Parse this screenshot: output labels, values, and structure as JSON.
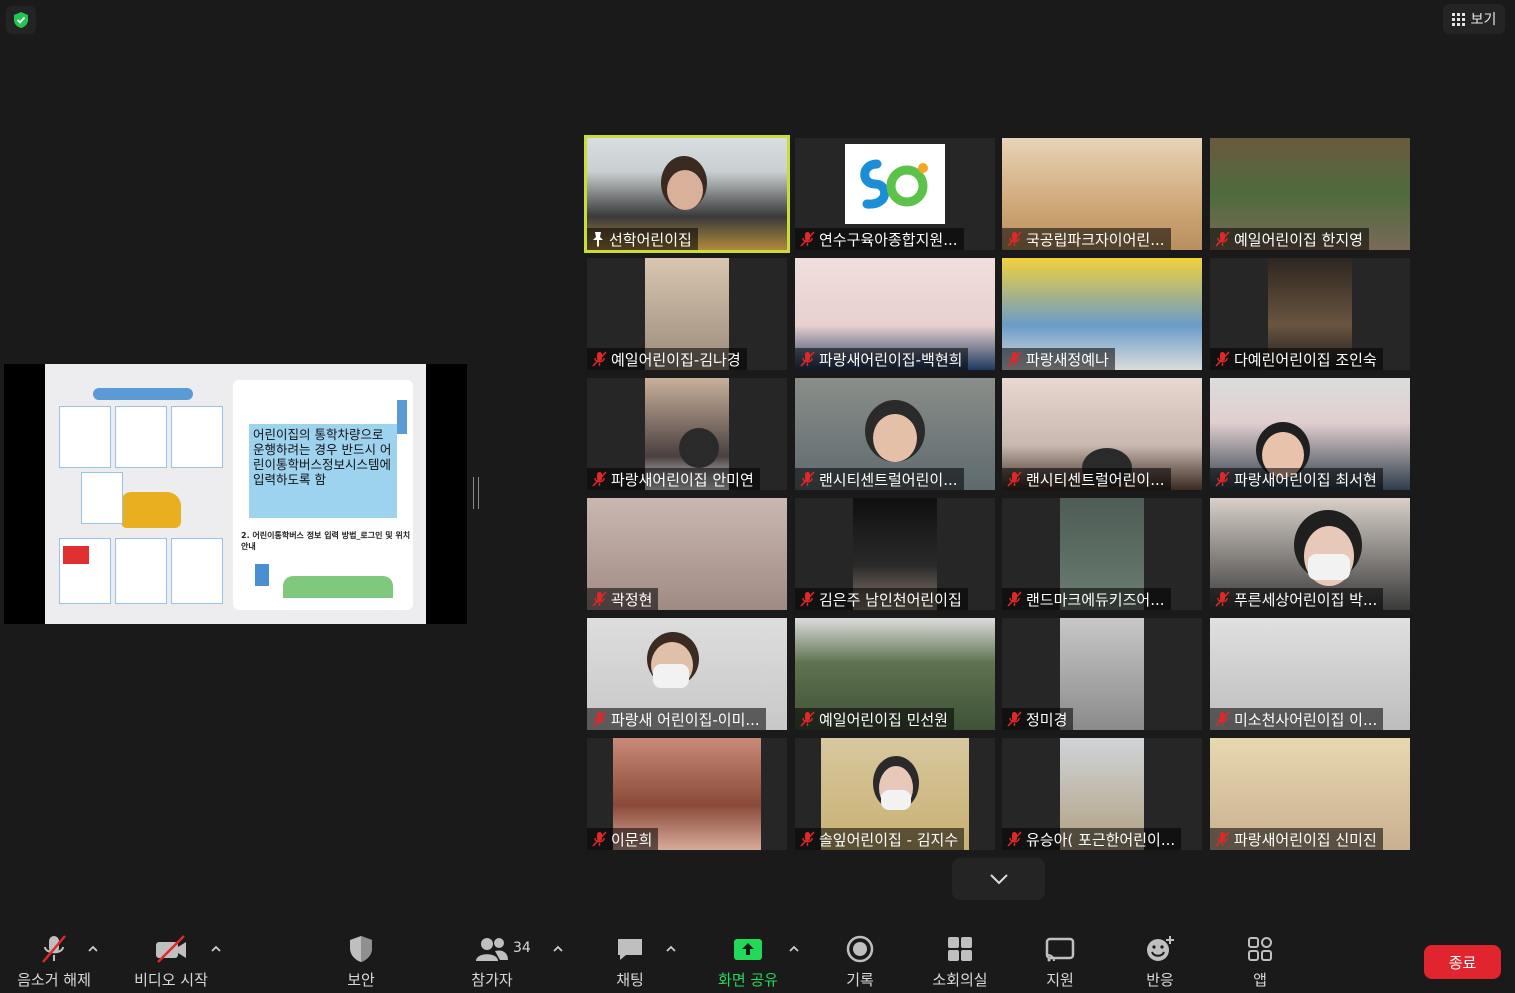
{
  "top_right": {
    "view_label": "보기"
  },
  "shared_slide": {
    "main_text": "어린이집의 통학차량으로 운행하려는 경우 반드시 어린이통학버스정보시스템에 입력하도록 함",
    "subheading": "2. 어린이통학버스 정보 입력 방법_로그인 및 위치 안내"
  },
  "participants": [
    {
      "name": "선학어린이집",
      "pinned": true,
      "muted": false,
      "active_speaker": true
    },
    {
      "name": "연수구육아종합지원...",
      "muted": true
    },
    {
      "name": "국공립파크자이어린...",
      "muted": true
    },
    {
      "name": "예일어린이집 한지영",
      "muted": true
    },
    {
      "name": "예일어린이집-김나경",
      "muted": true
    },
    {
      "name": "파랑새어린이집-백현희",
      "muted": true
    },
    {
      "name": "파랑새정예나",
      "muted": true
    },
    {
      "name": "다예린어린이집 조인숙",
      "muted": true
    },
    {
      "name": "파랑새어린이집 안미연",
      "muted": true
    },
    {
      "name": "랜시티센트럴어린이...",
      "muted": true
    },
    {
      "name": "랜시티센트럴어린이...",
      "muted": true
    },
    {
      "name": "파랑새어린이집 최서현",
      "muted": true
    },
    {
      "name": "곽정현",
      "muted": true
    },
    {
      "name": "김은주 남인천어린이집",
      "muted": true
    },
    {
      "name": "랜드마크에듀키즈어...",
      "muted": true
    },
    {
      "name": "푸른세상어린이집 박...",
      "muted": true
    },
    {
      "name": "파랑새 어린이집-이미...",
      "muted": true
    },
    {
      "name": "예일어린이집 민선원",
      "muted": true
    },
    {
      "name": "정미경",
      "muted": true
    },
    {
      "name": "미소천사어린이집 이...",
      "muted": true
    },
    {
      "name": "이문희",
      "muted": true
    },
    {
      "name": "솔잎어린이집 - 김지수",
      "muted": true
    },
    {
      "name": "유승아( 포근한어린이...",
      "muted": true
    },
    {
      "name": "파랑새어린이집 신미진",
      "muted": true
    }
  ],
  "toolbar": {
    "audio_label": "음소거 해제",
    "video_label": "비디오 시작",
    "security_label": "보안",
    "participants_label": "참가자",
    "participants_count": "34",
    "chat_label": "채팅",
    "share_label": "화면 공유",
    "record_label": "기록",
    "breakout_label": "소회의실",
    "support_label": "지원",
    "reactions_label": "반응",
    "apps_label": "앱",
    "end_label": "종료"
  },
  "colors": {
    "active_speaker_border": "#c8dc3c",
    "share_green": "#23d959",
    "end_red": "#e0252f",
    "muted_red": "#e02828"
  }
}
